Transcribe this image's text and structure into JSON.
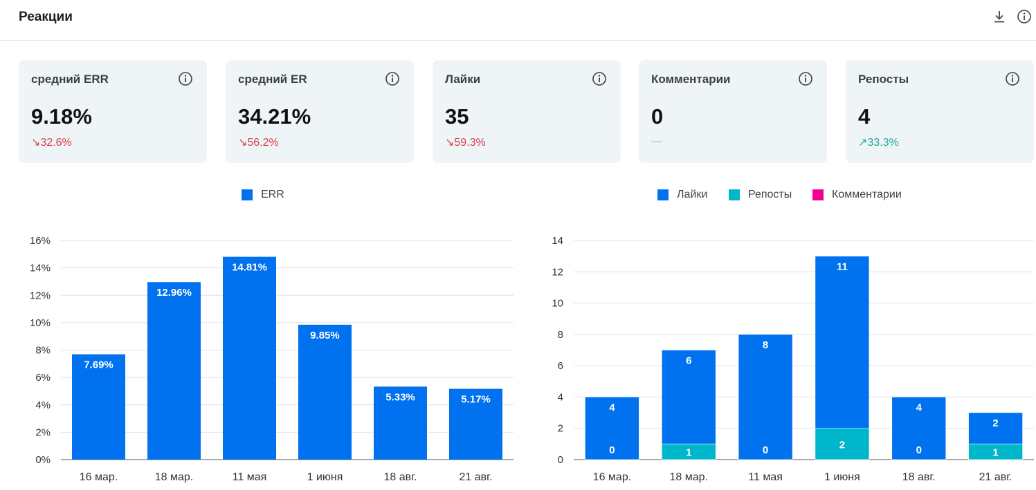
{
  "header": {
    "title": "Реакции",
    "download_icon": "download-icon",
    "info_icon": "info-icon"
  },
  "cards": [
    {
      "title": "средний ERR",
      "value": "9.18%",
      "delta_arrow": "↘",
      "delta": "32.6%",
      "trend": "down",
      "icon": "info-icon"
    },
    {
      "title": "средний ER",
      "value": "34.21%",
      "delta_arrow": "↘",
      "delta": "56.2%",
      "trend": "down",
      "icon": "info-icon"
    },
    {
      "title": "Лайки",
      "value": "35",
      "delta_arrow": "↘",
      "delta": "59.3%",
      "trend": "down",
      "icon": "info-icon"
    },
    {
      "title": "Комментарии",
      "value": "0",
      "delta_arrow": "",
      "delta": "—",
      "trend": "none",
      "icon": "info-icon"
    },
    {
      "title": "Репосты",
      "value": "4",
      "delta_arrow": "↗",
      "delta": "33.3%",
      "trend": "up",
      "icon": "info-icon"
    }
  ],
  "colors": {
    "likes": "#0072f0",
    "reposts": "#00b6cb",
    "comments": "#f10096",
    "err": "#0072f0",
    "down": "#d9404a",
    "up": "#1fa99b"
  },
  "chart_data": [
    {
      "type": "bar",
      "categories": [
        "16 мар.",
        "18 мар.",
        "11 мая",
        "1 июня",
        "18 авг.",
        "21 авг."
      ],
      "series": [
        {
          "name": "ERR",
          "values": [
            7.69,
            12.96,
            14.81,
            9.85,
            5.33,
            5.17
          ]
        }
      ],
      "data_labels": [
        "7.69%",
        "12.96%",
        "14.81%",
        "9.85%",
        "5.33%",
        "5.17%"
      ],
      "yticks": [
        "0%",
        "2%",
        "4%",
        "6%",
        "8%",
        "10%",
        "12%",
        "14%",
        "16%"
      ],
      "ylim": [
        0,
        16
      ],
      "legend_position": "top",
      "grid": true
    },
    {
      "type": "bar",
      "stacked": true,
      "categories": [
        "16 мар.",
        "18 мар.",
        "11 мая",
        "1 июня",
        "18 авг.",
        "21 авг."
      ],
      "series": [
        {
          "name": "Лайки",
          "values": [
            4,
            6,
            8,
            11,
            4,
            2
          ]
        },
        {
          "name": "Репосты",
          "values": [
            0,
            1,
            0,
            2,
            0,
            1
          ]
        },
        {
          "name": "Комментарии",
          "values": [
            0,
            0,
            0,
            0,
            0,
            0
          ]
        }
      ],
      "yticks": [
        "0",
        "2",
        "4",
        "6",
        "8",
        "10",
        "12",
        "14"
      ],
      "ylim": [
        0,
        14
      ],
      "legend_position": "top",
      "grid": true
    }
  ]
}
